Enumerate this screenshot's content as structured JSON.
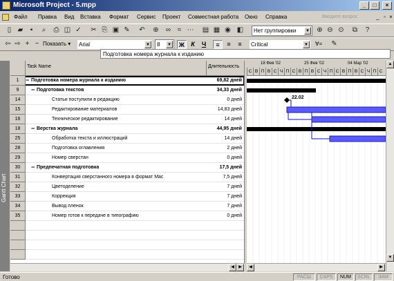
{
  "window": {
    "title": "Microsoft Project - 5.mpp"
  },
  "menu": {
    "items": [
      "Файл",
      "Правка",
      "Вид",
      "Вставка",
      "Формат",
      "Сервис",
      "Проект",
      "Совместная работа",
      "Окно",
      "Справка"
    ],
    "help_placeholder": "Введите вопрос"
  },
  "toolbar": {
    "grouping": "Нет группировки",
    "show_label": "Показать",
    "font": "Arial",
    "font_size": "8",
    "bold": "Ж",
    "italic": "К",
    "underline": "Ч",
    "filter": "Critical",
    "filter_icon": "∀="
  },
  "entry_bar": {
    "value": "Подготовка номера журнала к изданию"
  },
  "view_bar": {
    "label": "Gantt Chart"
  },
  "columns": {
    "task_name": "Task Name",
    "duration": "Длительность"
  },
  "tasks": [
    {
      "id": "1",
      "name": "Подготовка номера журнала к изданию",
      "duration": "69,82 дней",
      "level": 0,
      "summary": true
    },
    {
      "id": "9",
      "name": "Подготовка текстов",
      "duration": "34,33 дней",
      "level": 1,
      "summary": true
    },
    {
      "id": "14",
      "name": "Статьи поступили в редакцию",
      "duration": "0 дней",
      "level": 2,
      "summary": false
    },
    {
      "id": "15",
      "name": "Редактирование материалов",
      "duration": "14,83 дней",
      "level": 2,
      "summary": false
    },
    {
      "id": "16",
      "name": "Техническое редактирование",
      "duration": "14 дней",
      "level": 2,
      "summary": false
    },
    {
      "id": "18",
      "name": "Верстка журнала",
      "duration": "44,95 дней",
      "level": 1,
      "summary": true
    },
    {
      "id": "25",
      "name": "Обработка текста и иллюстраций",
      "duration": "14 дней",
      "level": 2,
      "summary": false
    },
    {
      "id": "28",
      "name": "Подготовка оглавления",
      "duration": "2 дней",
      "level": 2,
      "summary": false
    },
    {
      "id": "29",
      "name": "Номер сверстан",
      "duration": "0 дней",
      "level": 2,
      "summary": false
    },
    {
      "id": "30",
      "name": "Предпечатная подготовка",
      "duration": "17,5 дней",
      "level": 1,
      "summary": true
    },
    {
      "id": "31",
      "name": "Конвертация сверстанного номера в формат Mac",
      "duration": "7,5 дней",
      "level": 2,
      "summary": false
    },
    {
      "id": "32",
      "name": "Цветоделение",
      "duration": "7 дней",
      "level": 2,
      "summary": false
    },
    {
      "id": "33",
      "name": "Коррекция",
      "duration": "7 дней",
      "level": 2,
      "summary": false
    },
    {
      "id": "34",
      "name": "Вывод пленок",
      "duration": "7 дней",
      "level": 2,
      "summary": false
    },
    {
      "id": "35",
      "name": "Номер готов к передаче в типографию",
      "duration": "0 дней",
      "level": 2,
      "summary": false
    }
  ],
  "timescale": {
    "weeks": [
      "18 Фев '02",
      "25 Фев '02",
      "04 Мар '02"
    ],
    "days": [
      "С",
      "В",
      "П",
      "В",
      "С",
      "Ч",
      "П",
      "С",
      "В",
      "П",
      "В",
      "С",
      "Ч",
      "П",
      "С",
      "В",
      "П",
      "В",
      "С",
      "Ч",
      "П",
      "С"
    ]
  },
  "milestone_label": "22.02",
  "status": {
    "text": "Готово",
    "panels": [
      {
        "label": "РАСШ",
        "on": false
      },
      {
        "label": "CAPS",
        "on": false
      },
      {
        "label": "NUM",
        "on": true
      },
      {
        "label": "SCRL",
        "on": false
      },
      {
        "label": "ЗАМ",
        "on": false
      }
    ]
  }
}
